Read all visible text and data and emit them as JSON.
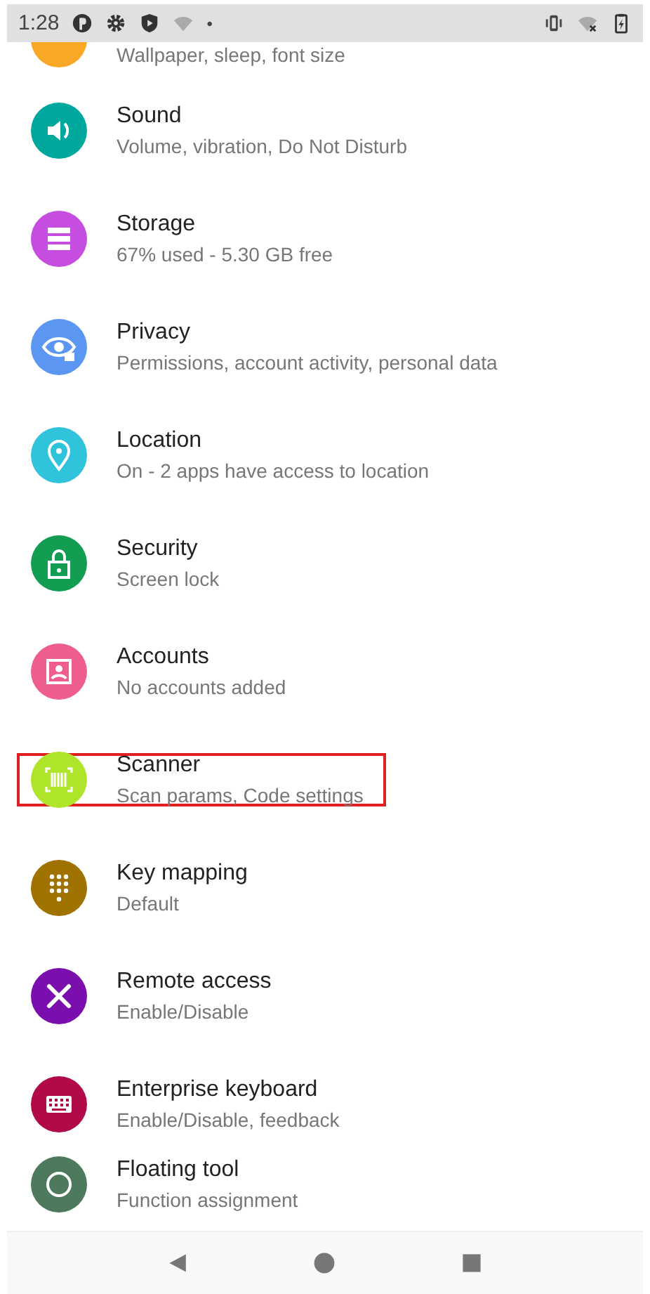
{
  "status_bar": {
    "time": "1:28",
    "dot": "•"
  },
  "settings": [
    {
      "kind": "display",
      "subtitle": "Wallpaper, sleep, font size",
      "color": "#f9a825",
      "selected": false
    },
    {
      "kind": "sound",
      "title": "Sound",
      "subtitle": "Volume, vibration, Do Not Disturb",
      "color": "#00a79d",
      "selected": false
    },
    {
      "kind": "storage",
      "title": "Storage",
      "subtitle": "67% used - 5.30 GB free",
      "color": "#c54ee0",
      "selected": false
    },
    {
      "kind": "privacy",
      "title": "Privacy",
      "subtitle": "Permissions, account activity, personal data",
      "color": "#5b96f2",
      "selected": false
    },
    {
      "kind": "location",
      "title": "Location",
      "subtitle": "On - 2 apps have access to location",
      "color": "#2fc3dc",
      "selected": false
    },
    {
      "kind": "security",
      "title": "Security",
      "subtitle": "Screen lock",
      "color": "#129d52",
      "selected": false
    },
    {
      "kind": "accounts",
      "title": "Accounts",
      "subtitle": "No accounts added",
      "color": "#ef5d8f",
      "selected": false
    },
    {
      "kind": "scanner",
      "title": "Scanner",
      "subtitle": "Scan params, Code settings",
      "color": "#aee42a",
      "selected": true
    },
    {
      "kind": "keys",
      "title": "Key mapping",
      "subtitle": "Default",
      "color": "#a07200",
      "selected": false
    },
    {
      "kind": "remote",
      "title": "Remote access",
      "subtitle": "Enable/Disable",
      "color": "#7b0fae",
      "selected": false
    },
    {
      "kind": "keyboard",
      "title": "Enterprise keyboard",
      "subtitle": "Enable/Disable, feedback",
      "color": "#b00a48",
      "selected": false
    },
    {
      "kind": "floating",
      "title": "Floating tool",
      "subtitle": "Function assignment",
      "color": "#4d7a5d",
      "selected": false
    }
  ]
}
